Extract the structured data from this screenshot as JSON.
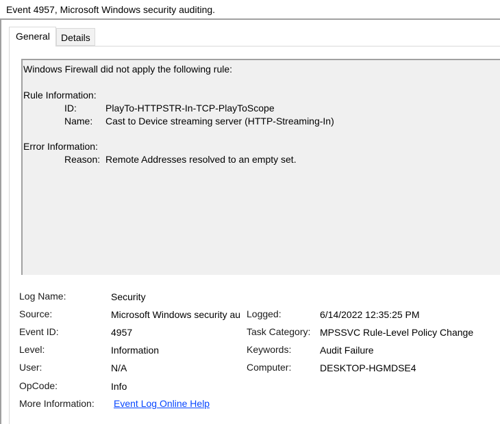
{
  "window": {
    "title": "Event 4957, Microsoft Windows security auditing."
  },
  "tabs": [
    {
      "label": "General"
    },
    {
      "label": "Details"
    }
  ],
  "description": {
    "line1": "Windows Firewall did not apply the following rule:",
    "rule_header": "Rule Information:",
    "rule_id_label": "ID:",
    "rule_id_value": "PlayTo-HTTPSTR-In-TCP-PlayToScope",
    "rule_name_label": "Name:",
    "rule_name_value": "Cast to Device streaming server (HTTP-Streaming-In)",
    "error_header": "Error Information:",
    "reason_label": "Reason:",
    "reason_value": "Remote Addresses resolved to an empty set."
  },
  "details": {
    "log_name_label": "Log Name:",
    "log_name_value": "Security",
    "source_label": "Source:",
    "source_value": "Microsoft Windows security auditing.",
    "logged_label": "Logged:",
    "logged_value": "6/14/2022 12:35:25 PM",
    "event_id_label": "Event ID:",
    "event_id_value": "4957",
    "task_category_label": "Task Category:",
    "task_category_value": "MPSSVC Rule-Level Policy Change",
    "level_label": "Level:",
    "level_value": "Information",
    "keywords_label": "Keywords:",
    "keywords_value": "Audit Failure",
    "user_label": "User:",
    "user_value": "N/A",
    "computer_label": "Computer:",
    "computer_value": "DESKTOP-HGMDSE4",
    "opcode_label": "OpCode:",
    "opcode_value": "Info",
    "more_info_label": "More Information:",
    "more_info_link": "Event Log Online Help"
  },
  "colors": {
    "link": "#0645ff",
    "border": "#a0a0a0",
    "description_bg": "#f0f0f0"
  }
}
